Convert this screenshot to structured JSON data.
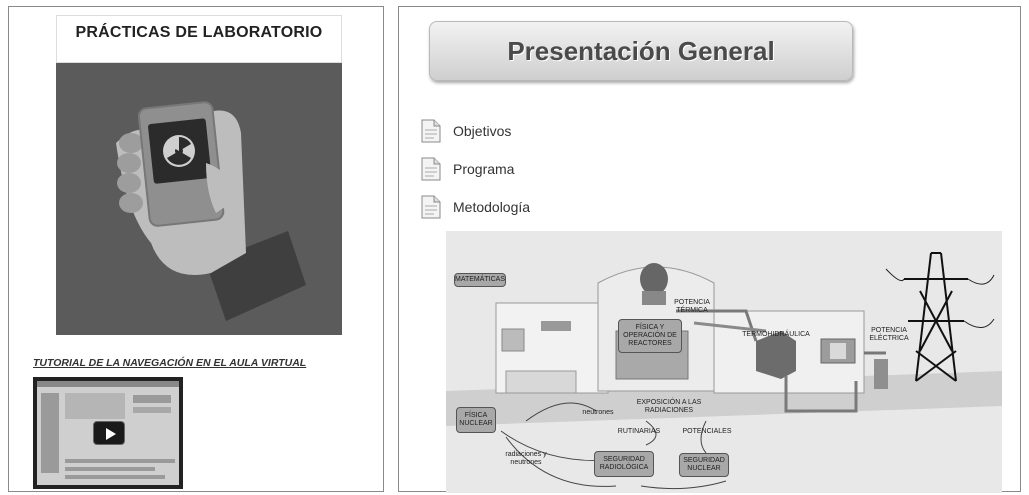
{
  "left_panel": {
    "title": "PRÁCTICAS DE LABORATORIO",
    "hero_icon": "radiation-phone-icon",
    "tutorial_link": "TUTORIAL DE LA NAVEGACIÓN EN EL AULA VIRTUAL",
    "video_icon": "play-icon"
  },
  "right_panel": {
    "header_title": "Presentación General",
    "menu": [
      {
        "label": "Objetivos",
        "icon": "document-icon"
      },
      {
        "label": "Programa",
        "icon": "document-icon"
      },
      {
        "label": "Metodología",
        "icon": "document-icon"
      }
    ]
  },
  "diagram": {
    "matematicas": "MATEMÁTICAS",
    "potencia_termica": "POTENCIA TÉRMICA",
    "fisica_operacion": "FÍSICA Y OPERACIÓN DE REACTORES",
    "termohidraulica": "TERMOHIDRÁULICA",
    "potencia_electrica": "POTENCIA ELÉCTRICA",
    "neutrones": "neutrones",
    "exposicion": "EXPOSICIÓN A LAS RADIACIONES",
    "fisica_nuclear": "FÍSICA NUCLEAR",
    "rutinarias": "RUTINARIAS",
    "potenciales": "POTENCIALES",
    "radiaciones_y_neutrones": "radiaciones y neutrones",
    "seguridad_radiologica": "SEGURIDAD RADIOLÓGICA",
    "seguridad_nuclear": "SEGURIDAD NUCLEAR"
  }
}
